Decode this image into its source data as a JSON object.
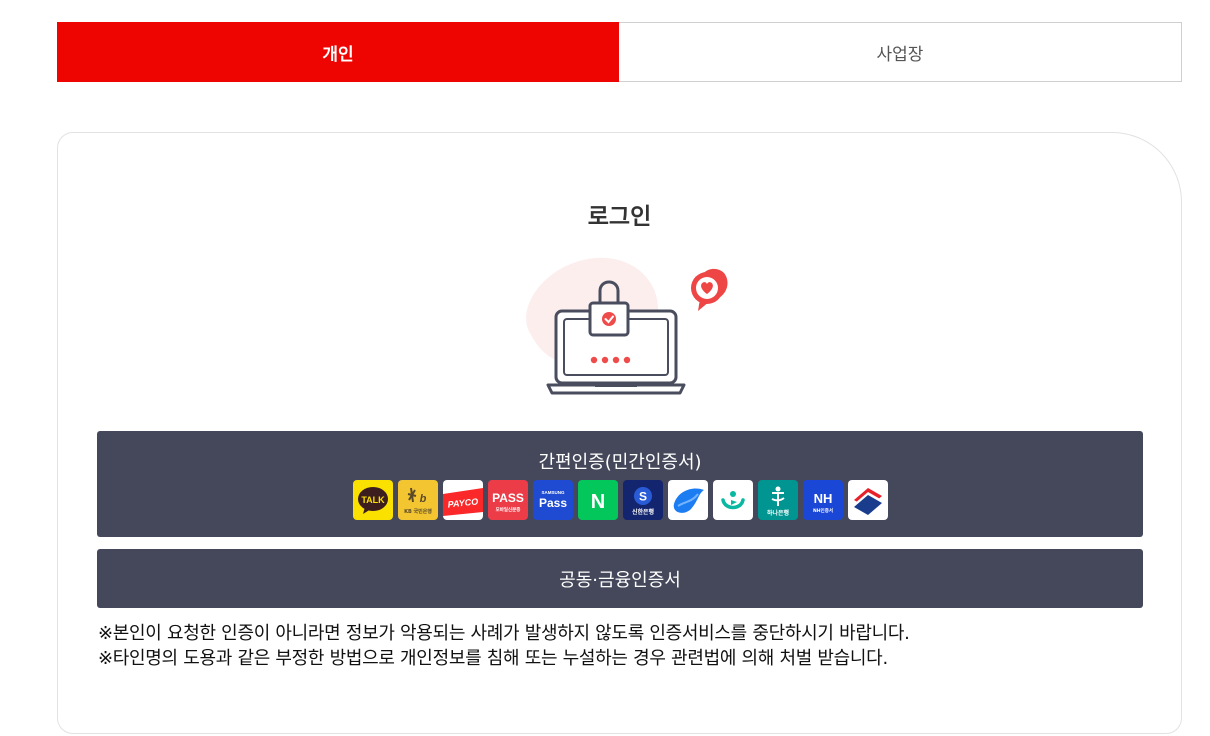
{
  "tabs": [
    {
      "label": "개인",
      "active": true
    },
    {
      "label": "사업장",
      "active": false
    }
  ],
  "login": {
    "title": "로그인"
  },
  "simple_auth": {
    "label": "간편인증(민간인증서)",
    "providers": [
      {
        "name": "kakaotalk",
        "text": "TALK"
      },
      {
        "name": "kb",
        "text": "KB 국민은행"
      },
      {
        "name": "payco",
        "text": "PAYCO"
      },
      {
        "name": "pass",
        "text": "PASS",
        "sub": "모바일신분증"
      },
      {
        "name": "samsung-pass",
        "text": "Pass",
        "sub": "SAMSUNG"
      },
      {
        "name": "naver",
        "text": "N"
      },
      {
        "name": "shinhan",
        "text": "신한은행"
      },
      {
        "name": "toss",
        "text": ""
      },
      {
        "name": "banksalad",
        "text": ""
      },
      {
        "name": "hana",
        "text": "하나은행"
      },
      {
        "name": "nh",
        "text": "NH",
        "sub": "NH인증서"
      },
      {
        "name": "woori",
        "text": ""
      }
    ]
  },
  "cert_button": {
    "label": "공동·금융인증서"
  },
  "notices": [
    "※본인이 요청한 인증이 아니라면 정보가 악용되는 사례가 발생하지 않도록 인증서비스를 중단하시기 바랍니다.",
    "※타인명의 도용과 같은 부정한 방법으로 개인정보를 침해 또는 누설하는 경우 관련법에 의해 처벌 받습니다."
  ],
  "colors": {
    "accent": "#ee0502",
    "button": "#45485b"
  }
}
